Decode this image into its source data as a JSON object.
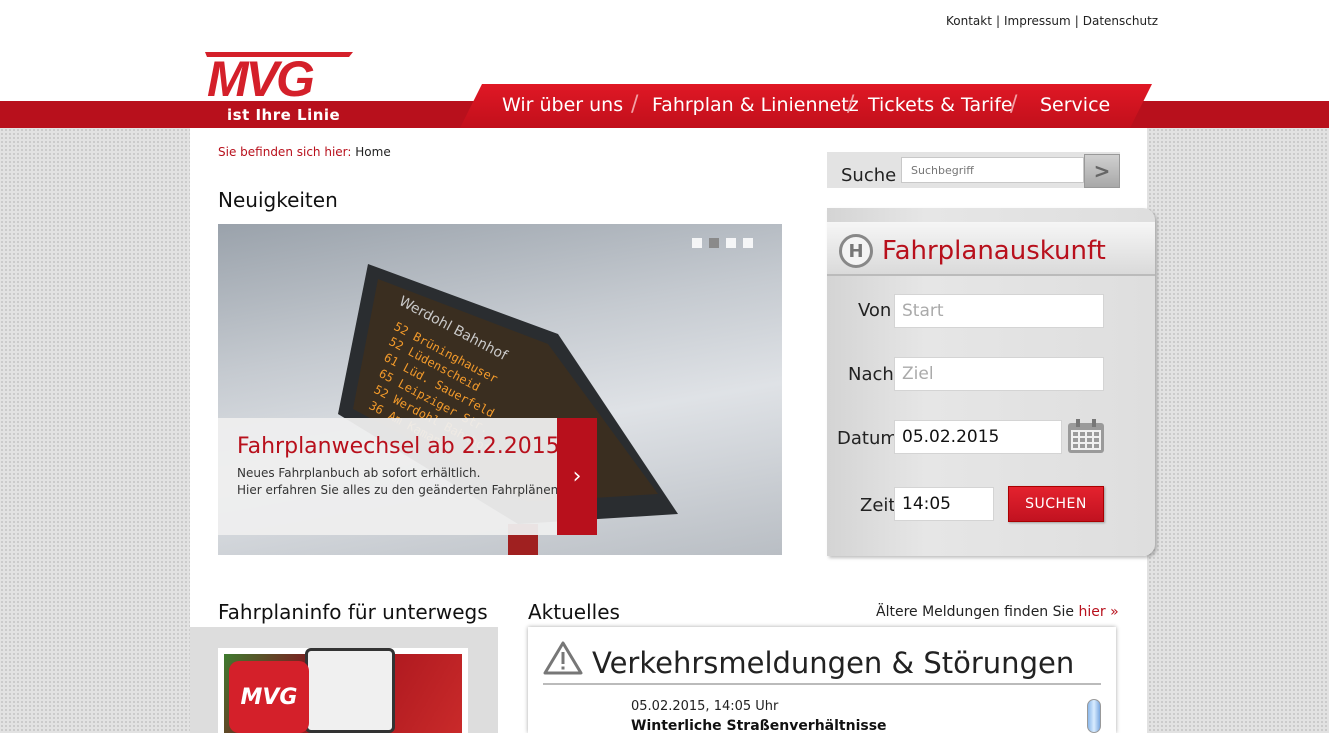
{
  "top_links": [
    "Kontakt",
    "Impressum",
    "Datenschutz"
  ],
  "top_links_sep": "|",
  "logo": {
    "text": "MVG",
    "tagline": "ist Ihre Linie"
  },
  "nav": {
    "items": [
      "Wir über uns",
      "Fahrplan & Liniennetz",
      "Tickets & Tarife",
      "Service"
    ],
    "separator": "/"
  },
  "breadcrumb": {
    "label": "Sie befinden sich hier:",
    "current": "Home"
  },
  "search": {
    "label": "Suche",
    "placeholder": "Suchbegriff",
    "button": ">"
  },
  "news": {
    "heading": "Neuigkeiten",
    "slide_title": "Fahrplanwechsel ab 2.2.2015",
    "slide_text_1": "Neues Fahrplanbuch ab sofort erhältlich.",
    "slide_text_2": "Hier erfahren Sie alles zu den geänderten Fahrplänen.",
    "slide_button": "›",
    "slide_count": 4,
    "active_slide": 2,
    "sign_lines": [
      "Werdohl Bahnhof"
    ]
  },
  "fahrplan": {
    "icon_letter": "H",
    "title": "Fahrplanauskunft",
    "from_label": "Von",
    "from_placeholder": "Start",
    "to_label": "Nach",
    "to_placeholder": "Ziel",
    "date_label": "Datum",
    "date_value": "05.02.2015",
    "time_label": "Zeit",
    "time_value": "14:05",
    "submit": "SUCHEN"
  },
  "unterwegs": {
    "heading": "Fahrplaninfo für unterwegs",
    "app_logo": "MVG"
  },
  "aktuelles": {
    "heading": "Aktuelles",
    "older_text": "Ältere Meldungen finden Sie",
    "older_link": "hier »",
    "box_title": "Verkehrsmeldungen & Störungen",
    "item_date": "05.02.2015, 14:05 Uhr",
    "item_title": "Winterliche Straßenverhältnisse"
  },
  "colors": {
    "brand_red": "#b8101c",
    "accent_red": "#e01825"
  }
}
